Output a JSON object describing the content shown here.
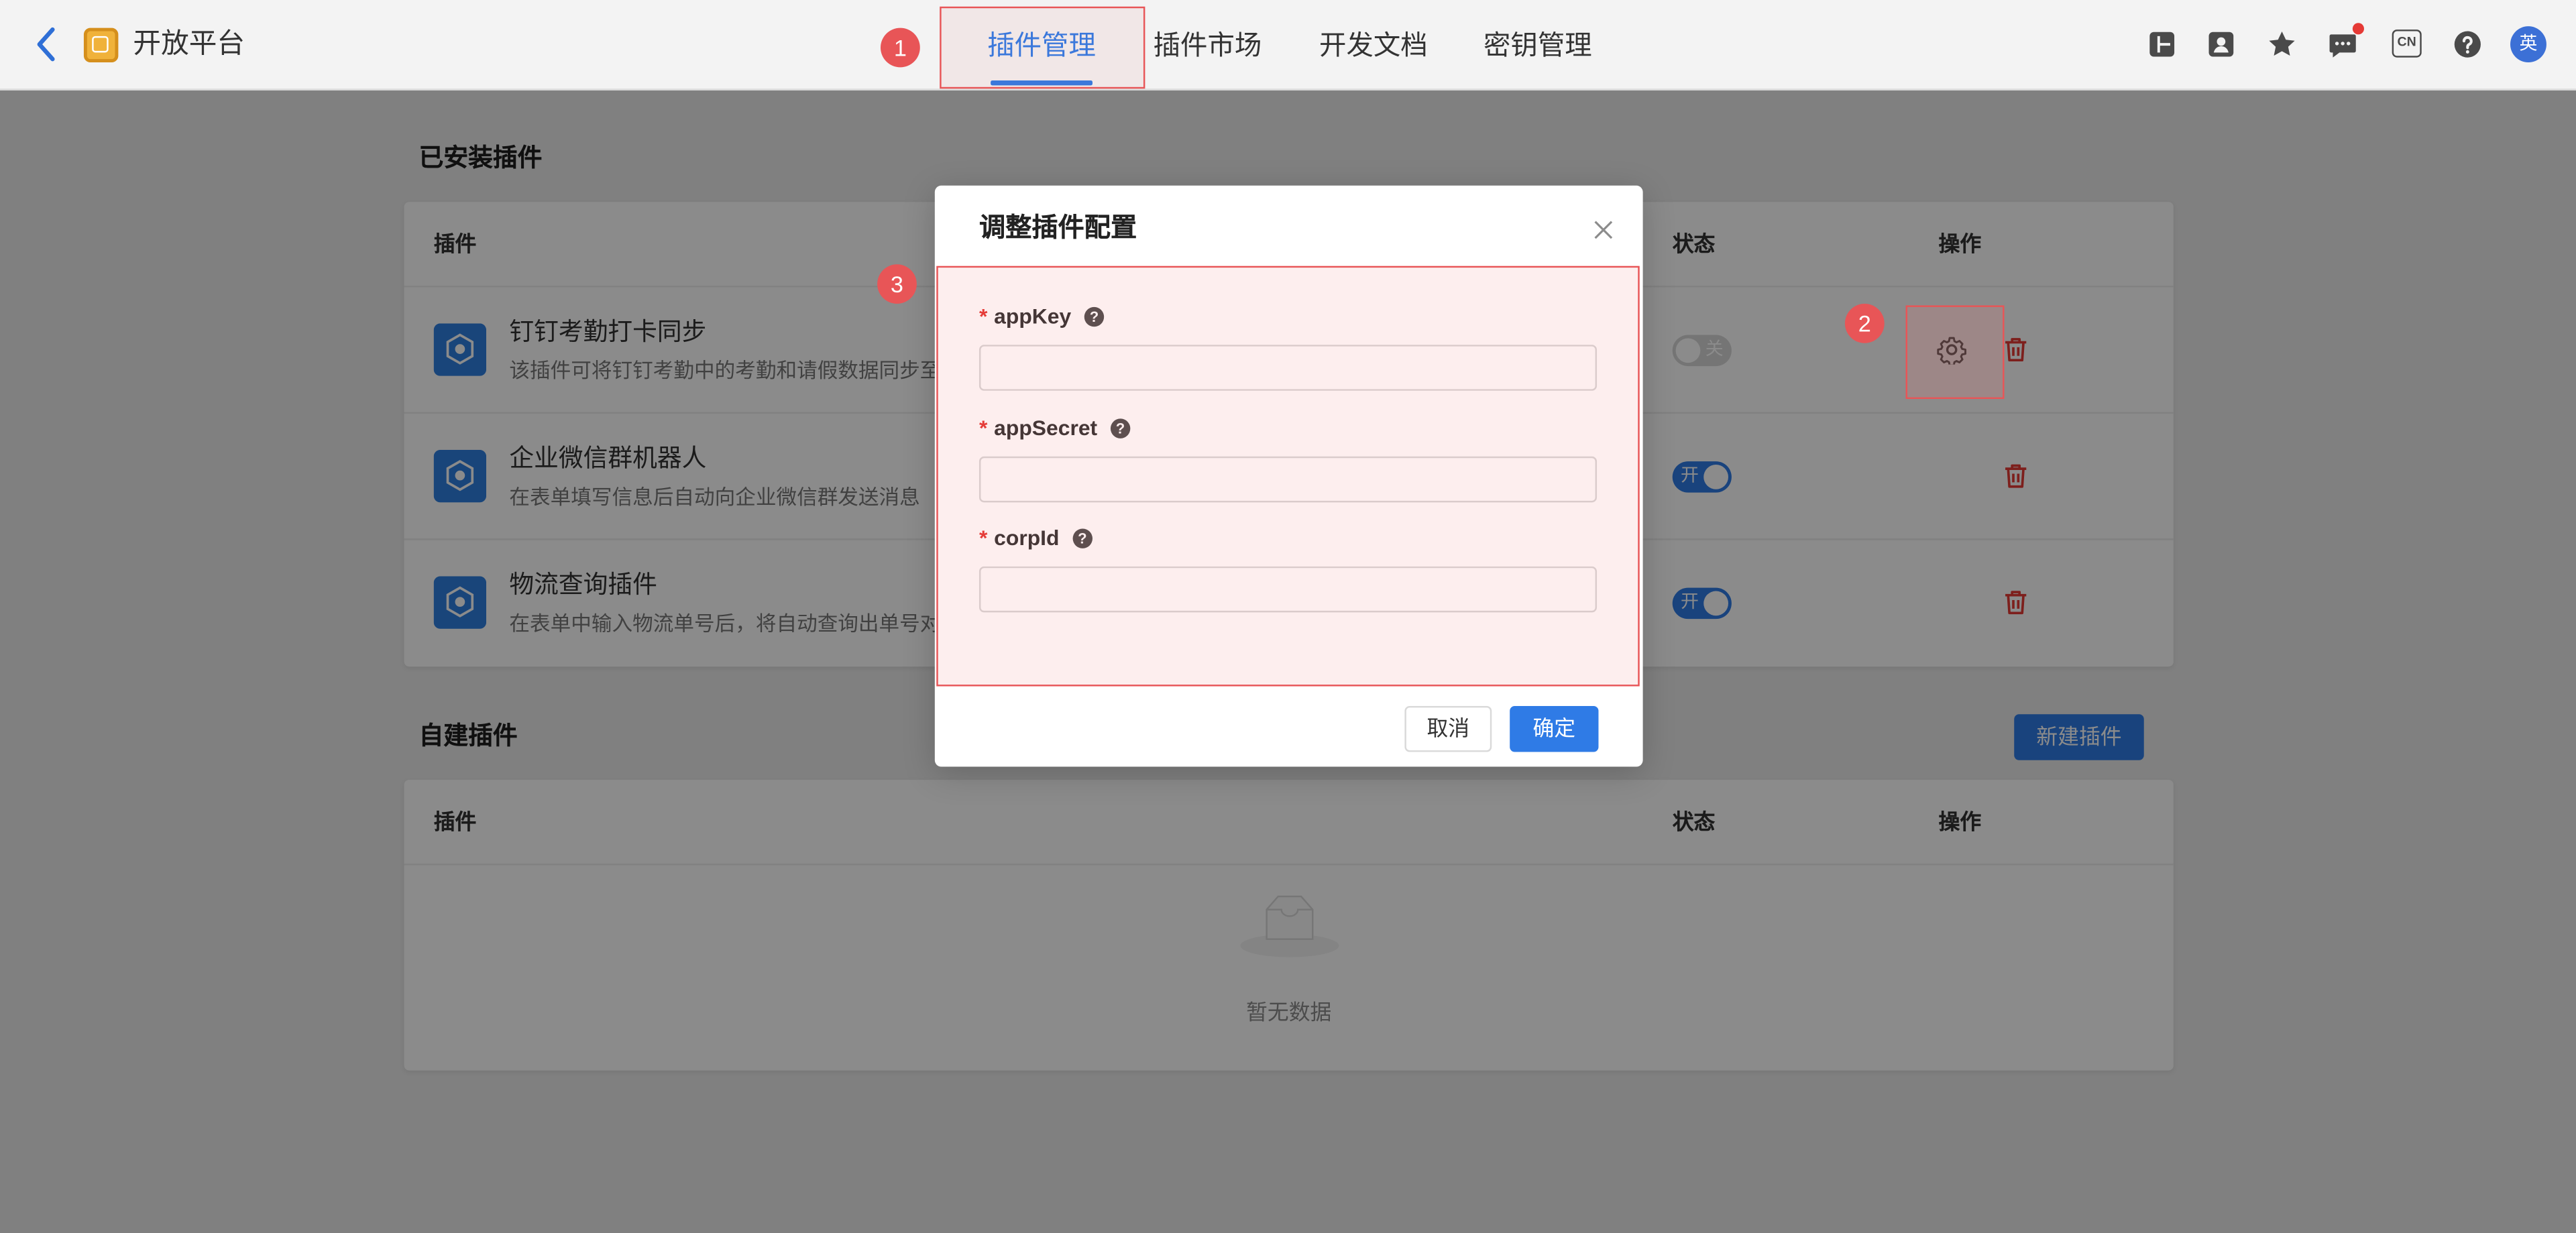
{
  "colors": {
    "accent": "#2f7be6",
    "annotation_red": "#e85557",
    "danger": "#e53935",
    "toggle_off": "#d6d6d6"
  },
  "header": {
    "app_title": "开放平台",
    "tabs": [
      {
        "label": "插件管理",
        "active": true
      },
      {
        "label": "插件市场",
        "active": false
      },
      {
        "label": "开发文档",
        "active": false
      },
      {
        "label": "密钥管理",
        "active": false
      }
    ],
    "right_icons": [
      "layout-icon",
      "contacts-icon",
      "star-icon",
      "message-icon",
      "language-icon",
      "help-icon",
      "avatar"
    ],
    "language_label": "CN",
    "avatar_text": "英"
  },
  "installed_plugins": {
    "section_title": "已安装插件",
    "columns": {
      "plugin": "插件",
      "status": "状态",
      "actions": "操作"
    },
    "rows": [
      {
        "name": "钉钉考勤打卡同步",
        "description": "该插件可将钉钉考勤中的考勤和请假数据同步至",
        "enabled": false,
        "status_label": "关",
        "icon": "plugin-icon",
        "actions": [
          "settings-icon",
          "delete-icon"
        ]
      },
      {
        "name": "企业微信群机器人",
        "description": "在表单填写信息后自动向企业微信群发送消息",
        "enabled": true,
        "status_label": "开",
        "icon": "plugin-icon",
        "actions": [
          "delete-icon"
        ]
      },
      {
        "name": "物流查询插件",
        "description": "在表单中输入物流单号后，将自动查询出单号对",
        "enabled": true,
        "status_label": "开",
        "icon": "plugin-icon",
        "actions": [
          "delete-icon"
        ]
      }
    ]
  },
  "custom_plugins": {
    "section_title": "自建插件",
    "new_button_label": "新建插件",
    "columns": {
      "plugin": "插件",
      "status": "状态",
      "actions": "操作"
    },
    "empty_text": "暂无数据"
  },
  "modal": {
    "title": "调整插件配置",
    "fields": [
      {
        "label": "appKey",
        "required_mark": "*",
        "value": "",
        "help_icon": "help-icon"
      },
      {
        "label": "appSecret",
        "required_mark": "*",
        "value": "",
        "help_icon": "help-icon"
      },
      {
        "label": "corpId",
        "required_mark": "*",
        "value": "",
        "help_icon": "help-icon"
      }
    ],
    "cancel_label": "取消",
    "confirm_label": "确定"
  },
  "annotations": [
    {
      "label": "1"
    },
    {
      "label": "2"
    },
    {
      "label": "3"
    }
  ]
}
